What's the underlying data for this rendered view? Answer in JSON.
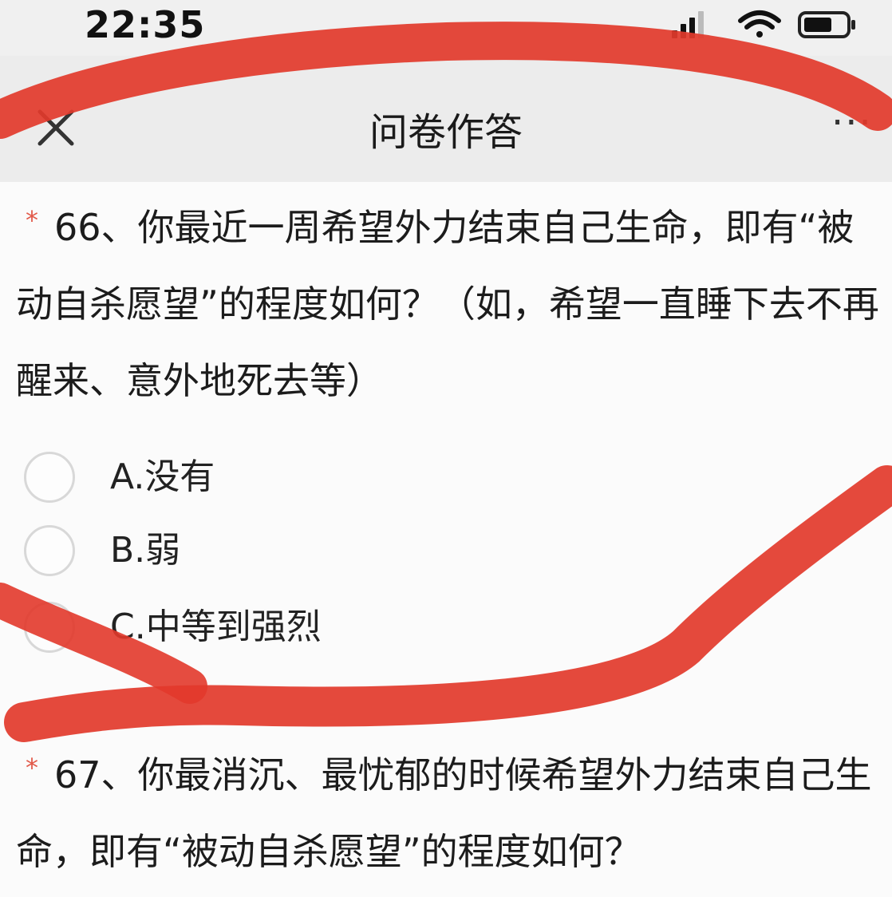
{
  "status_bar": {
    "time": "22:35",
    "icons": [
      "signal-icon",
      "wifi-icon",
      "battery-icon"
    ]
  },
  "nav": {
    "title": "问卷作答",
    "close_icon": "close-icon",
    "more_label": "···"
  },
  "questions": [
    {
      "required_mark": "*",
      "text": "66、你最近一周希望外力结束自己生命，即有“被动自杀愿望”的程度如何？（如，希望一直睡下去不再醒来、意外地死去等）",
      "options": [
        "A.没有",
        "B.弱",
        "C.中等到强烈"
      ]
    },
    {
      "required_mark": "*",
      "text": "67、你最消沉、最忧郁的时候希望外力结束自己生命，即有“被动自杀愿望”的程度如何？"
    }
  ],
  "colors": {
    "marker_red": "#e2392b",
    "required_star": "#e25a4a",
    "radio_border": "#d8d8d8"
  }
}
